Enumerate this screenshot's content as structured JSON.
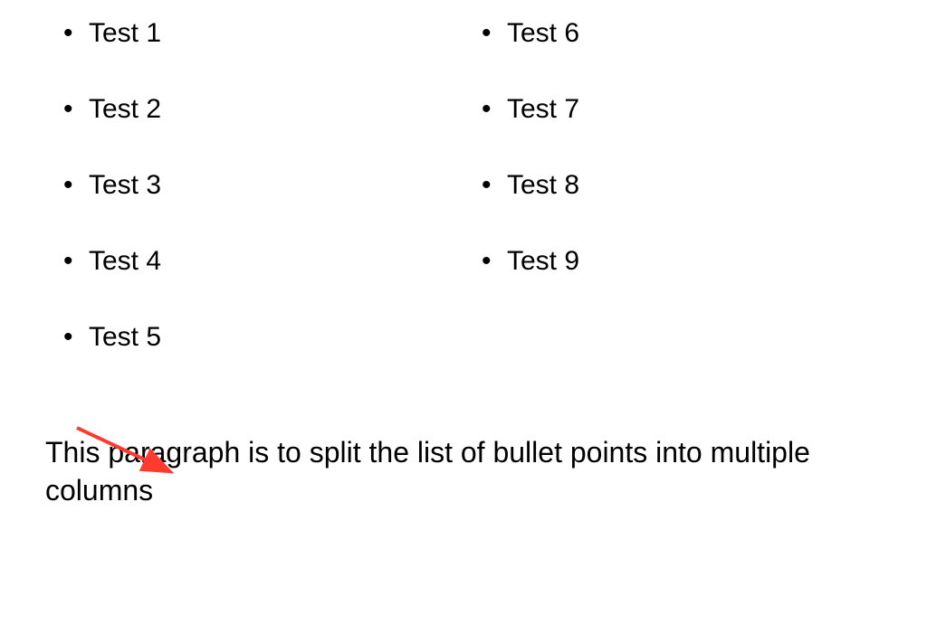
{
  "list": {
    "col1": [
      "Test 1",
      "Test 2",
      "Test 3",
      "Test 4",
      "Test 5"
    ],
    "col2": [
      "Test 6",
      "Test 7",
      "Test 8",
      "Test 9"
    ]
  },
  "paragraph": "This paragraph is to split the list of bullet points into multiple columns",
  "annotation": {
    "arrow_color": "#ff3b30"
  }
}
